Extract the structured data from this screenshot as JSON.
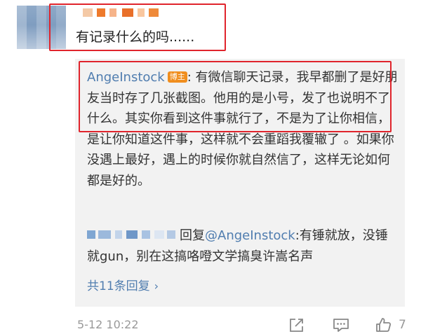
{
  "comment": {
    "text": "有记录什么的吗......"
  },
  "reply": {
    "author": "AngeInstock",
    "badge": "博主",
    "separator": ":",
    "text": "有微信聊天记录，我早都删了是好朋友当时存了几张截图。他用的是小号，发了也说明不了什么。其实你看到这件事就行了，不是为了让你相信，是让你知道这件事，这样就不会重蹈我覆辙了 。如果你没遇上最好，遇上的时候你就自然信了，这样无论如何都是好的。"
  },
  "sub_reply": {
    "reply_word": "回复",
    "mention": "@AngeInstock",
    "text": ":有锤就放，没锤就gun，别在这搞咯噔文学搞臭许嵩名声"
  },
  "more_replies": {
    "label": "共11条回复",
    "chevron": "›"
  },
  "footer": {
    "timestamp": "5-12 10:22",
    "like_count": "7",
    "icons": [
      "share-icon",
      "comment-icon",
      "like-icon"
    ]
  },
  "colors": {
    "highlight_border": "#e0242c",
    "link": "#507daf",
    "badge": "#f08e1e",
    "panel_bg": "#f2f2f2",
    "muted": "#999999"
  }
}
